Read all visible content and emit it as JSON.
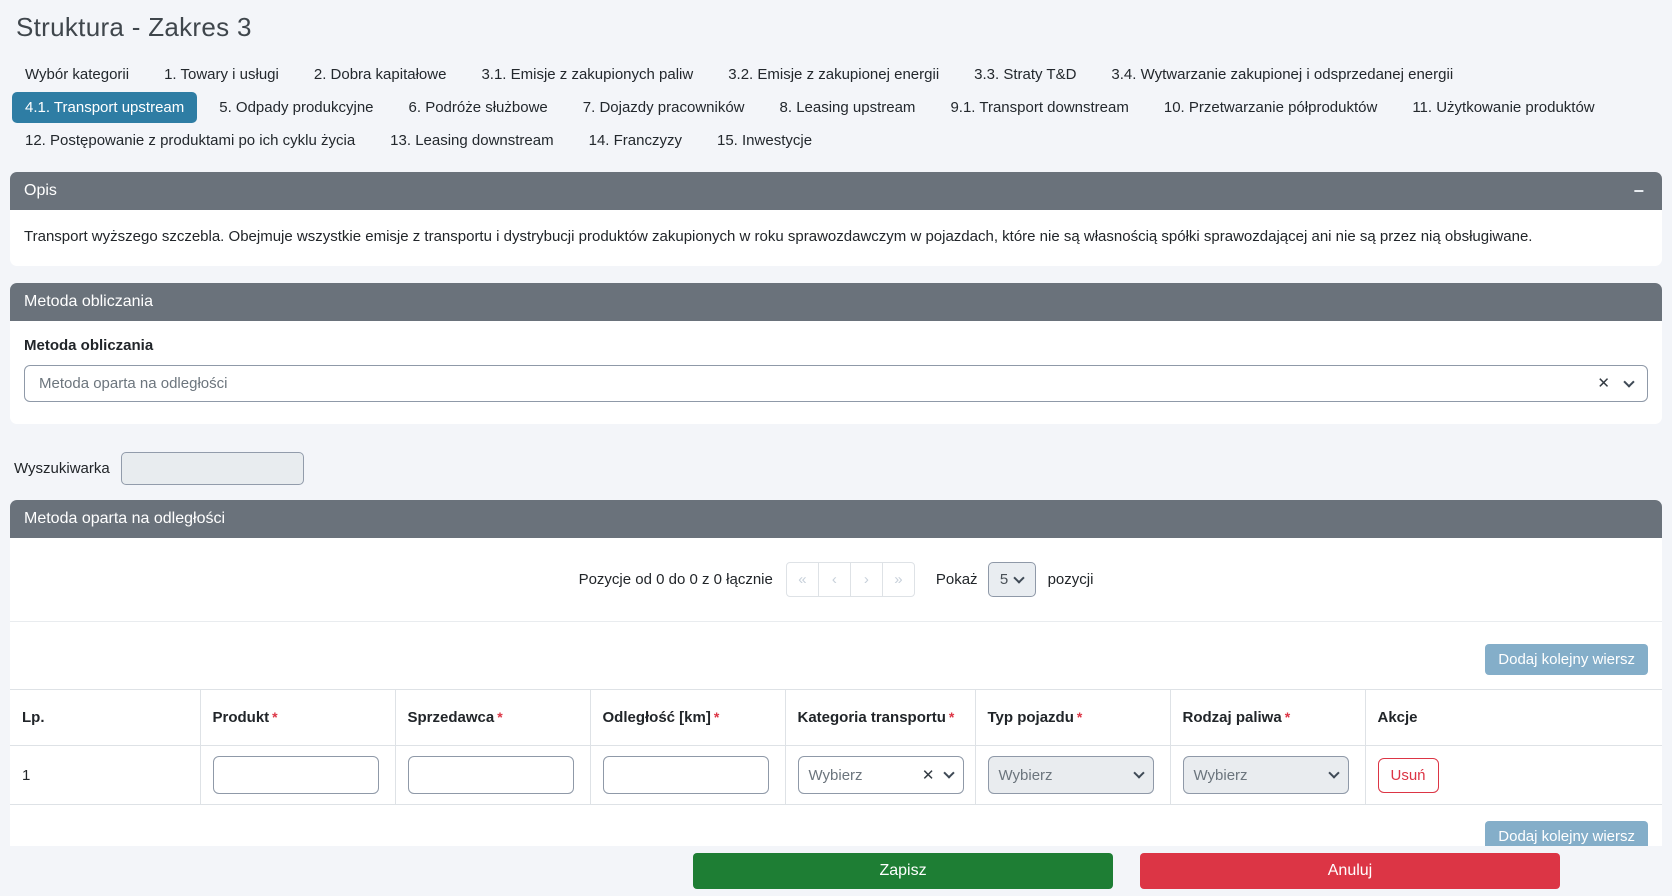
{
  "page": {
    "title": "Struktura - Zakres 3"
  },
  "icons": {
    "collapse_minus": "−",
    "clear": "✕",
    "page_first": "«",
    "page_prev": "‹",
    "page_next": "›",
    "page_last": "»"
  },
  "required_marker": "*",
  "colors": {
    "active_tab": "#2e7da4",
    "section_header": "#6a727b",
    "add_button": "#84aec9",
    "save_green": "#1e7e34",
    "danger_red": "#dc3545",
    "page_background": "#f3f5f9"
  },
  "tabs": {
    "rows": [
      {
        "items": [
          {
            "label": "Wybór kategorii"
          },
          {
            "label": "1. Towary i usługi"
          },
          {
            "label": "2. Dobra kapitałowe"
          },
          {
            "label": "3.1. Emisje z zakupionych paliw"
          },
          {
            "label": "3.2. Emisje z zakupionej energii"
          },
          {
            "label": "3.3. Straty T&D"
          },
          {
            "label": "3.4. Wytwarzanie zakupionej i odsprzedanej energii"
          }
        ]
      },
      {
        "items": [
          {
            "label": "4.1. Transport upstream",
            "active": true
          },
          {
            "label": "5. Odpady produkcyjne"
          },
          {
            "label": "6. Podróże służbowe"
          },
          {
            "label": "7. Dojazdy pracowników"
          },
          {
            "label": "8. Leasing upstream"
          },
          {
            "label": "9.1. Transport downstream"
          },
          {
            "label": "10. Przetwarzanie półproduktów"
          },
          {
            "label": "11. Użytkowanie produktów"
          }
        ]
      },
      {
        "items": [
          {
            "label": "12. Postępowanie z produktami po ich cyklu życia"
          },
          {
            "label": "13. Leasing downstream"
          },
          {
            "label": "14. Franczyzy"
          },
          {
            "label": "15. Inwestycje"
          }
        ]
      }
    ]
  },
  "opis": {
    "header": "Opis",
    "description": "Transport wyższego szczebla. Obejmuje wszystkie emisje z transportu i dystrybucji produktów zakupionych w roku sprawozdawczym w pojazdach, które nie są własnością spółki sprawozdającej ani nie są przez nią obsługiwane."
  },
  "metoda": {
    "header": "Metoda obliczania",
    "field_label": "Metoda obliczania",
    "selected_value": "Metoda oparta na odległości"
  },
  "search": {
    "label": "Wyszukiwarka",
    "value": ""
  },
  "list": {
    "header": "Metoda oparta na odległości",
    "pagination": {
      "info": "Pozycje od 0 do 0 z 0 łącznie",
      "show_label": "Pokaż",
      "page_size": "5",
      "suffix_label": "pozycji"
    },
    "add_row_label": "Dodaj kolejny wiersz",
    "columns": [
      {
        "label": "Lp.",
        "required": false
      },
      {
        "label": "Produkt",
        "required": true
      },
      {
        "label": "Sprzedawca",
        "required": true
      },
      {
        "label": "Odległość [km]",
        "required": true
      },
      {
        "label": "Kategoria transportu",
        "required": true
      },
      {
        "label": "Typ pojazdu",
        "required": true
      },
      {
        "label": "Rodzaj paliwa",
        "required": true
      },
      {
        "label": "Akcje",
        "required": false
      }
    ],
    "rows": [
      {
        "lp": "1",
        "produkt": "",
        "sprzedawca": "",
        "odleglosc": "",
        "kategoria_placeholder": "Wybierz",
        "typ_pojazdu_placeholder": "Wybierz",
        "rodzaj_paliwa_placeholder": "Wybierz",
        "delete_label": "Usuń"
      }
    ]
  },
  "footer": {
    "save_label": "Zapisz",
    "cancel_label": "Anuluj"
  }
}
